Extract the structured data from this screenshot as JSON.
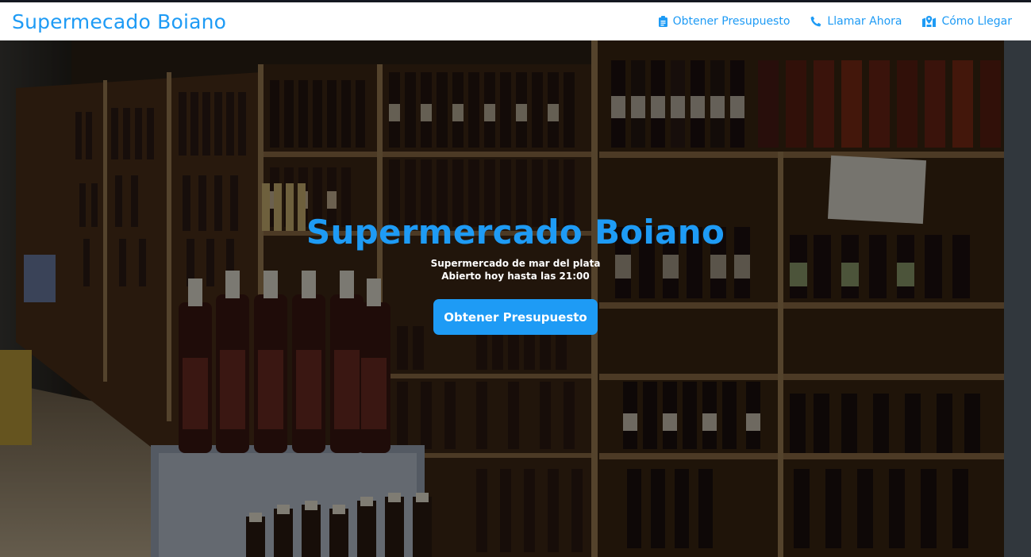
{
  "navbar": {
    "brand": "Supermecado Boiano",
    "links": [
      {
        "label": "Obtener Presupuesto",
        "icon": "clipboard-icon"
      },
      {
        "label": "Llamar Ahora",
        "icon": "phone-icon"
      },
      {
        "label": "Cómo Llegar",
        "icon": "map-icon"
      }
    ]
  },
  "hero": {
    "title": "Supermercado Boiano",
    "subtitle_line1": "Supermercado de mar del plata",
    "subtitle_line2": "Abierto hoy hasta las 21:00",
    "cta_label": "Obtener Presupuesto",
    "background_image": "wine-shop-shelves"
  },
  "colors": {
    "accent": "#1e9bf5",
    "navbar_bg": "#ffffff",
    "button_text": "#ffffff"
  }
}
